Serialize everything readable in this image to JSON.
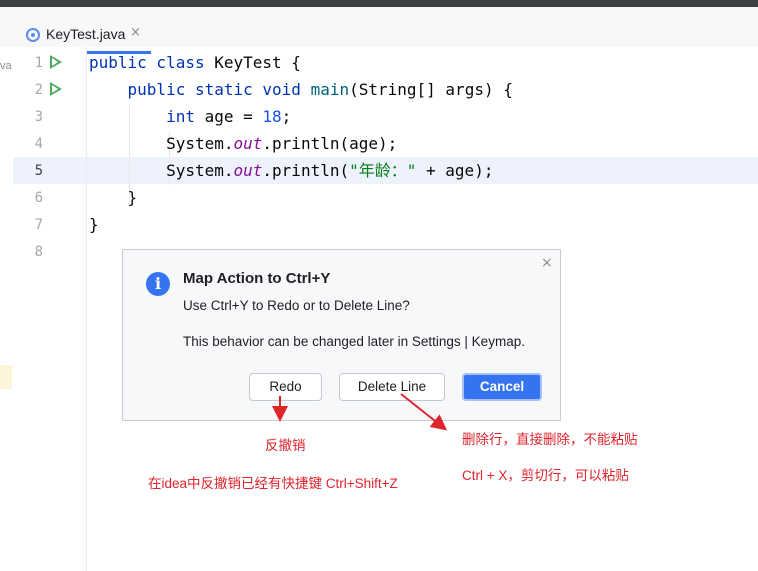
{
  "tab": {
    "label": "KeyTest.java",
    "close": "×"
  },
  "left_strip_text": "va",
  "editor": {
    "line_numbers": [
      "1",
      "2",
      "3",
      "4",
      "5",
      "6",
      "7",
      "8"
    ],
    "lines": [
      {
        "indent": "",
        "tokens": [
          {
            "t": "public class ",
            "c": "kw"
          },
          {
            "t": "KeyTest {",
            "c": ""
          }
        ]
      },
      {
        "indent": "    ",
        "tokens": [
          {
            "t": "public static void ",
            "c": "kw"
          },
          {
            "t": "main",
            "c": "fn"
          },
          {
            "t": "(String[] args) {",
            "c": ""
          }
        ]
      },
      {
        "indent": "        ",
        "tokens": [
          {
            "t": "int ",
            "c": "kw"
          },
          {
            "t": "age = ",
            "c": ""
          },
          {
            "t": "18",
            "c": "num"
          },
          {
            "t": ";",
            "c": ""
          }
        ]
      },
      {
        "indent": "        ",
        "tokens": [
          {
            "t": "System.",
            "c": ""
          },
          {
            "t": "out",
            "c": "fld"
          },
          {
            "t": ".println(age);",
            "c": ""
          }
        ]
      },
      {
        "indent": "        ",
        "tokens": [
          {
            "t": "System.",
            "c": ""
          },
          {
            "t": "out",
            "c": "fld"
          },
          {
            "t": ".println(",
            "c": ""
          },
          {
            "t": "\"年龄：\"",
            "c": "str"
          },
          {
            "t": " + age);",
            "c": ""
          }
        ]
      },
      {
        "indent": "    ",
        "tokens": [
          {
            "t": "}",
            "c": ""
          }
        ]
      },
      {
        "indent": "",
        "tokens": [
          {
            "t": "}",
            "c": ""
          }
        ]
      },
      {
        "indent": "",
        "tokens": []
      }
    ]
  },
  "dialog": {
    "title": "Map Action to Ctrl+Y",
    "message": "Use Ctrl+Y to Redo or to Delete Line?",
    "message2": "This behavior can be changed later in Settings | Keymap.",
    "info_icon": "i",
    "close": "×",
    "buttons": {
      "redo": "Redo",
      "delete_line": "Delete Line",
      "cancel": "Cancel"
    }
  },
  "annotations": {
    "redo_note": "反撤销",
    "delete_note": "删除行，直接删除，不能粘贴",
    "cut_note": "Ctrl + X，剪切行，可以粘贴",
    "idea_note": "在idea中反撤销已经有快捷键 Ctrl+Shift+Z"
  },
  "colors": {
    "accent": "#3574f0",
    "annotation": "#e0242c",
    "run_icon": "#4eac5a",
    "current_line": "#edf2fc"
  }
}
